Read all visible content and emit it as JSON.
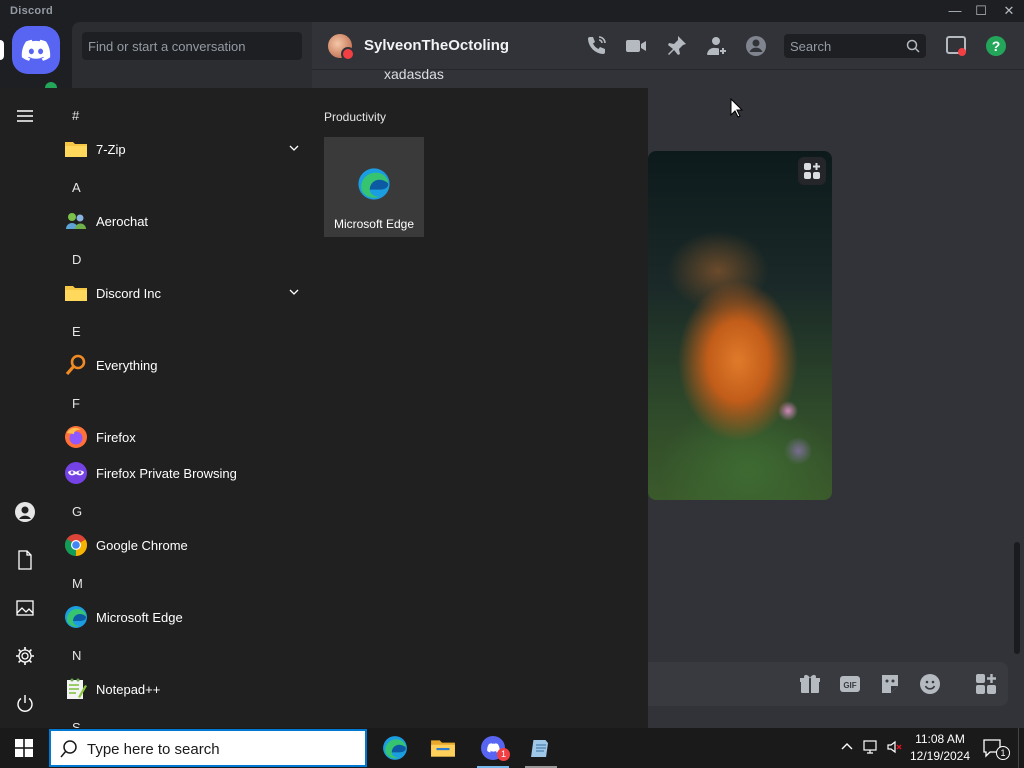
{
  "window": {
    "app_title": "Discord"
  },
  "discord": {
    "dm_search_placeholder": "Find or start a conversation",
    "header": {
      "username": "SylveonTheOctoling",
      "search_placeholder": "Search"
    },
    "messages": [
      {
        "text": "xadasdas"
      }
    ],
    "colors": {
      "blurple": "#5865f2",
      "online": "#23a55a",
      "dnd": "#f23f43",
      "help": "#23a55a"
    }
  },
  "start_menu": {
    "groups": [
      {
        "letter": "#",
        "apps": [
          {
            "name": "7-Zip",
            "icon": "folder-icon",
            "expandable": true
          }
        ]
      },
      {
        "letter": "A",
        "apps": [
          {
            "name": "Aerochat",
            "icon": "aerochat-icon",
            "expandable": false
          }
        ]
      },
      {
        "letter": "D",
        "apps": [
          {
            "name": "Discord Inc",
            "icon": "folder-icon",
            "expandable": true
          }
        ]
      },
      {
        "letter": "E",
        "apps": [
          {
            "name": "Everything",
            "icon": "magnifier-icon",
            "expandable": false
          }
        ]
      },
      {
        "letter": "F",
        "apps": [
          {
            "name": "Firefox",
            "icon": "firefox-icon",
            "expandable": false
          },
          {
            "name": "Firefox Private Browsing",
            "icon": "firefox-private-icon",
            "expandable": false
          }
        ]
      },
      {
        "letter": "G",
        "apps": [
          {
            "name": "Google Chrome",
            "icon": "chrome-icon",
            "expandable": false
          }
        ]
      },
      {
        "letter": "M",
        "apps": [
          {
            "name": "Microsoft Edge",
            "icon": "edge-icon",
            "expandable": false
          }
        ]
      },
      {
        "letter": "N",
        "apps": [
          {
            "name": "Notepad++",
            "icon": "notepadpp-icon",
            "expandable": false
          }
        ]
      },
      {
        "letter": "S",
        "apps": []
      }
    ],
    "tiles_group": "Productivity",
    "tiles": [
      {
        "label": "Microsoft Edge",
        "icon": "edge-icon"
      }
    ],
    "rail_icons": [
      "hamburger-icon",
      "user-icon",
      "documents-icon",
      "pictures-icon",
      "settings-icon",
      "power-icon"
    ]
  },
  "taskbar": {
    "search_placeholder": "Type here to search",
    "pinned": [
      "edge-icon",
      "file-explorer-icon",
      "discord-icon",
      "notepad-icon"
    ],
    "discord_badge": "1",
    "time": "11:08 AM",
    "date": "12/19/2024",
    "notification_count": "1"
  }
}
